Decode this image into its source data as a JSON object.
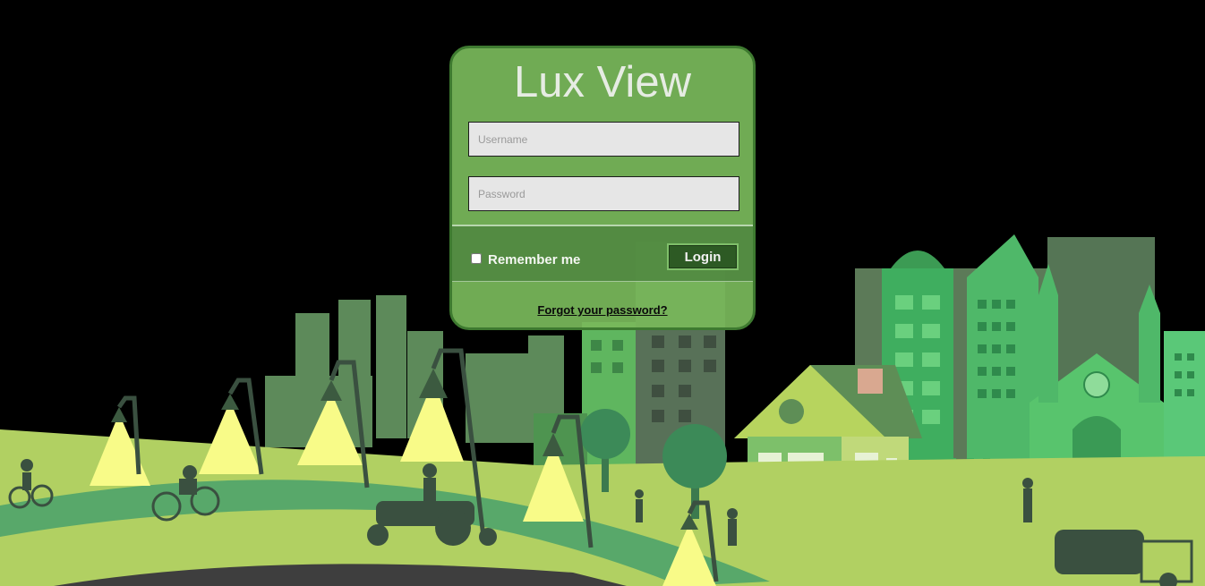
{
  "app": {
    "title": "Lux View"
  },
  "login": {
    "username_placeholder": "Username",
    "password_placeholder": "Password",
    "remember_label": "Remember me",
    "login_label": "Login",
    "forgot_label": "Forgot your password?"
  },
  "colors": {
    "panel": "#78b85a",
    "panel_border": "#3e7a30",
    "button": "#2d5a24",
    "lamp_light": "#f8fb88",
    "grass_light": "#b1d062",
    "grass_dark": "#58a86a",
    "building_dark": "#5c8060",
    "building_light": "#66c774"
  }
}
